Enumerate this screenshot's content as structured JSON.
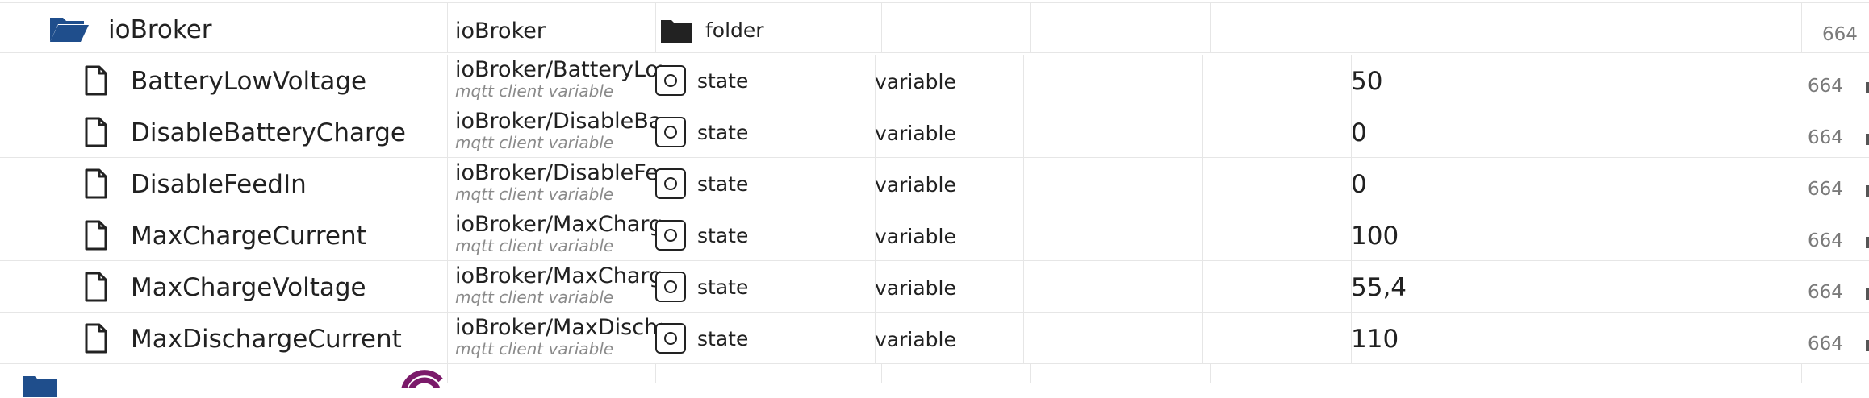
{
  "parent": {
    "name": "ioBroker",
    "id": "ioBroker",
    "type": "folder",
    "acl": "664"
  },
  "rows": [
    {
      "name": "BatteryLowVoltage",
      "id": "ioBroker/BatteryLowVoltage",
      "desc": "mqtt client variable",
      "type": "state",
      "role": "variable",
      "value": "50",
      "acl": "664"
    },
    {
      "name": "DisableBatteryCharge",
      "id": "ioBroker/DisableBatteryCharge",
      "desc": "mqtt client variable",
      "type": "state",
      "role": "variable",
      "value": "0",
      "acl": "664"
    },
    {
      "name": "DisableFeedIn",
      "id": "ioBroker/DisableFeedIn",
      "desc": "mqtt client variable",
      "type": "state",
      "role": "variable",
      "value": "0",
      "acl": "664"
    },
    {
      "name": "MaxChargeCurrent",
      "id": "ioBroker/MaxChargeCurrent",
      "desc": "mqtt client variable",
      "type": "state",
      "role": "variable",
      "value": "100",
      "acl": "664"
    },
    {
      "name": "MaxChargeVoltage",
      "id": "ioBroker/MaxChargeVoltage",
      "desc": "mqtt client variable",
      "type": "state",
      "role": "variable",
      "value": "55,4",
      "acl": "664"
    },
    {
      "name": "MaxDischargeCurrent",
      "id": "ioBroker/MaxDischargeCurrent",
      "desc": "mqtt client variable",
      "type": "state",
      "role": "variable",
      "value": "110",
      "acl": "664"
    }
  ],
  "icons": {
    "parent": "folder-open-icon",
    "parent_type": "folder-icon",
    "state_rows": "file-icon",
    "state_type": "state-type-icon",
    "next_row": "folder-icon",
    "next_row_adapter": "adapter-logo-icon"
  },
  "colors": {
    "folder_blue": "#1f4e8c",
    "adapter_purple": "#7b1a6a",
    "grid_line": "#e6e6e6",
    "muted_text": "#8a8a8a"
  }
}
